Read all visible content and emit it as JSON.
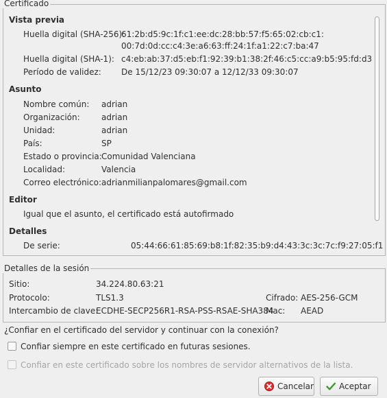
{
  "certificate": {
    "legend": "Certificado",
    "preview": {
      "title": "Vista previa",
      "sha256_label": "Huella digital (SHA-256):",
      "sha256_value_line1": "61:2b:d5:9c:1f:c1:ee:dc:28:bb:57:f5:65:02:cb:c1:",
      "sha256_value_line2": "00:7d:0d:cc:c4:3e:a6:63:ff:24:1f:a1:22:c7:ba:47",
      "sha1_label": "Huella digital (SHA-1):",
      "sha1_value": "c4:eb:ab:37:d5:eb:f1:92:39:b1:38:2f:46:c5:cc:a9:b5:95:fd:d3",
      "validity_label": "Período de validez:",
      "validity_value": "De 15/12/23 09:30:07 a 12/12/33 09:30:07"
    },
    "subject": {
      "title": "Asunto",
      "fields": [
        {
          "label": "Nombre común:",
          "value": "adrian"
        },
        {
          "label": "Organización:",
          "value": "adrian"
        },
        {
          "label": "Unidad:",
          "value": "adrian"
        },
        {
          "label": "País:",
          "value": "SP"
        },
        {
          "label": "Estado o provincia:",
          "value": "Comunidad Valenciana"
        },
        {
          "label": "Localidad:",
          "value": "Valencia"
        },
        {
          "label": "Correo electrónico:",
          "value": "adrianmilianpalomares@gmail.com"
        }
      ]
    },
    "issuer": {
      "title": "Editor",
      "text": "Igual que el asunto, el certificado está autofirmado"
    },
    "details": {
      "title": "Detalles",
      "serial_label": "De serie:",
      "serial_value": "05:44:66:61:85:69:b8:1f:82:35:b9:d4:43:3c:3c:7c:f9:27:05:f1"
    }
  },
  "session": {
    "legend": "Detalles de la sesión",
    "site_label": "Sitio:",
    "site_value": "34.224.80.63:21",
    "protocol_label": "Protocolo:",
    "protocol_value": "TLS1.3",
    "cipher_label": "Cifrado:",
    "cipher_value": "AES-256-GCM",
    "kex_label": "Intercambio de clave:",
    "kex_value": "ECDHE-SECP256R1-RSA-PSS-RSAE-SHA384",
    "mac_label": "Mac:",
    "mac_value": "AEAD"
  },
  "question": "¿Confiar en el certificado del servidor y continuar con la conexión?",
  "options": {
    "always_trust": "Confiar siempre en este certificado en futuras sesiones.",
    "trust_alt_names": "Confiar en este certificado sobre los nombres de servidor alternativos de la lista."
  },
  "buttons": {
    "cancel": "Cancelar",
    "accept": "Aceptar"
  }
}
